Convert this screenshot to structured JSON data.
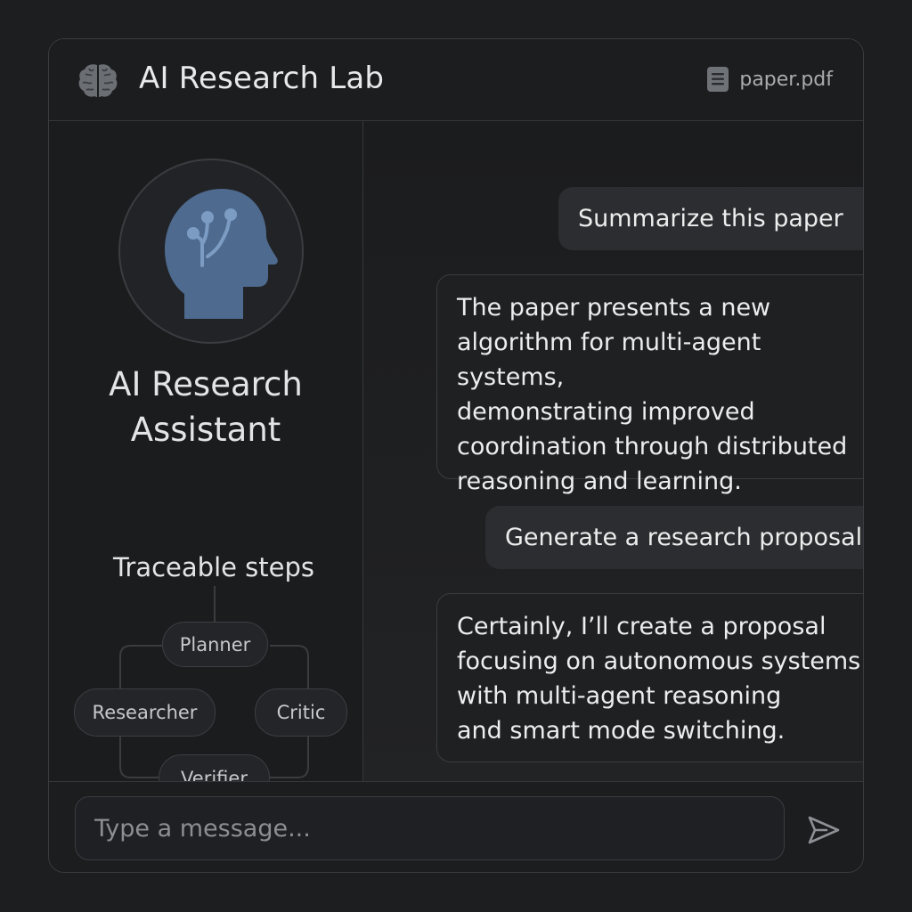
{
  "header": {
    "title": "AI Research Lab",
    "logo_icon": "brain-icon",
    "file": {
      "icon": "document-icon",
      "name": "paper.pdf"
    }
  },
  "sidebar": {
    "avatar_icon": "head-circuit-icon",
    "assistant_name_line1": "AI Research",
    "assistant_name_line2": "Assistant",
    "steps_title": "Traceable steps",
    "steps": {
      "planner": "Planner",
      "researcher": "Researcher",
      "critic": "Critic",
      "verifier": "Verifier"
    }
  },
  "chat": {
    "messages": [
      {
        "role": "user",
        "text": "Summarize this paper"
      },
      {
        "role": "assistant",
        "lines": [
          "The paper presents a new",
          "algorithm for multi-agent systems,",
          "demonstrating improved",
          "coordination through distributed",
          "reasoning and learning."
        ]
      },
      {
        "role": "user",
        "text": "Generate a research proposal"
      },
      {
        "role": "assistant",
        "lines": [
          "Certainly, I’ll create a proposal",
          "focusing on autonomous systems",
          "with multi-agent reasoning",
          "and smart mode switching."
        ]
      }
    ]
  },
  "composer": {
    "placeholder": "Type a message...",
    "send_icon": "send-icon"
  },
  "colors": {
    "background": "#1d1e20",
    "panel": "#1a1b1d",
    "border": "#3a3c40",
    "user_bubble": "#2c2d30",
    "accent_avatar": "#4e6a8e",
    "text": "#e6e7e9",
    "muted_text": "#a9abaf"
  }
}
